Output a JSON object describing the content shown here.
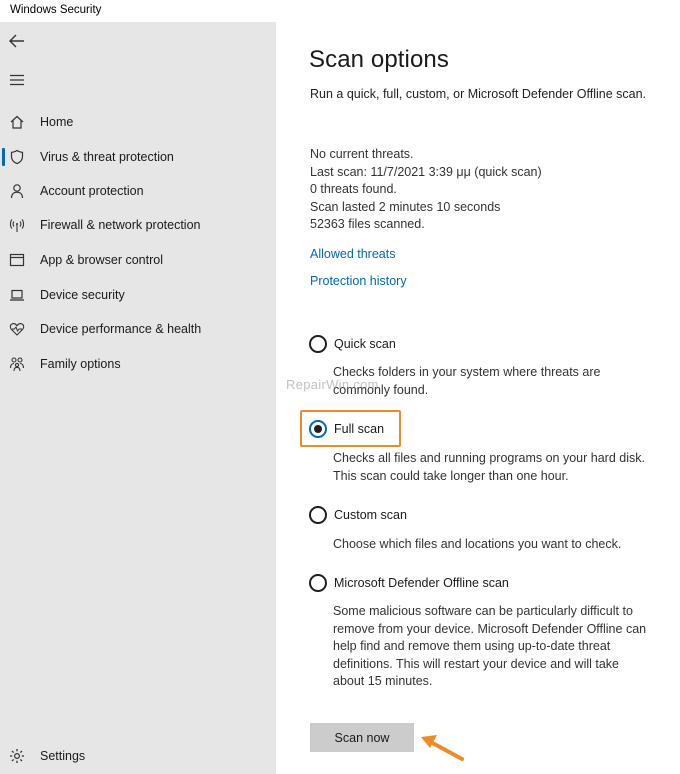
{
  "window": {
    "title": "Windows Security"
  },
  "sidebar": {
    "back_icon": "back-arrow-icon",
    "menu_icon": "hamburger-menu-icon",
    "items": [
      {
        "label": "Home",
        "icon": "home-icon",
        "active": false
      },
      {
        "label": "Virus & threat protection",
        "icon": "shield-icon",
        "active": true
      },
      {
        "label": "Account protection",
        "icon": "person-icon",
        "active": false
      },
      {
        "label": "Firewall & network protection",
        "icon": "wifi-antenna-icon",
        "active": false
      },
      {
        "label": "App & browser control",
        "icon": "browser-window-icon",
        "active": false
      },
      {
        "label": "Device security",
        "icon": "laptop-icon",
        "active": false
      },
      {
        "label": "Device performance & health",
        "icon": "heart-pulse-icon",
        "active": false
      },
      {
        "label": "Family options",
        "icon": "family-icon",
        "active": false
      }
    ],
    "settings": {
      "label": "Settings",
      "icon": "gear-icon"
    }
  },
  "main": {
    "title": "Scan options",
    "subtitle": "Run a quick, full, custom, or Microsoft Defender Offline scan.",
    "status": {
      "threats": "No current threats.",
      "last_scan": "Last scan: 11/7/2021 3:39 μμ (quick scan)",
      "threats_found": "0 threats found.",
      "duration": "Scan lasted 2 minutes 10 seconds",
      "files_scanned": "52363 files scanned."
    },
    "links": {
      "allowed_threats": "Allowed threats",
      "protection_history": "Protection history"
    },
    "options": [
      {
        "label": "Quick scan",
        "description": "Checks folders in your system where threats are commonly found.",
        "selected": false
      },
      {
        "label": "Full scan",
        "description": "Checks all files and running programs on your hard disk. This scan could take longer than one hour.",
        "selected": true
      },
      {
        "label": "Custom scan",
        "description": "Choose which files and locations you want to check.",
        "selected": false
      },
      {
        "label": "Microsoft Defender Offline scan",
        "description": "Some malicious software can be particularly difficult to remove from your device. Microsoft Defender Offline can help find and remove them using up-to-date threat definitions. This will restart your device and will take about 15 minutes.",
        "selected": false
      }
    ],
    "scan_button": "Scan now",
    "watermark": "RepairWin.com"
  },
  "colors": {
    "accent": "#0067c0",
    "sidebar_bg": "#e6e6e6",
    "highlight": "#f08a24",
    "button_bg": "#cccccc"
  }
}
